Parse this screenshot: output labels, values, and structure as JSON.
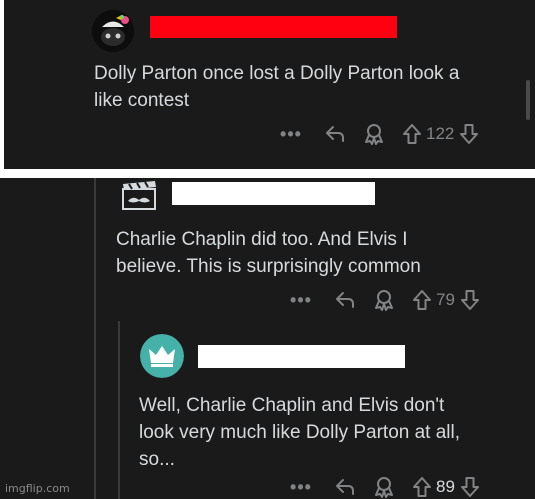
{
  "comments": [
    {
      "text_lines": [
        "Dolly Parton once lost a Dolly Parton look a",
        "like contest"
      ],
      "username_redaction_color": "#ff0011",
      "score": "122"
    },
    {
      "text_lines": [
        "Charlie Chaplin did too. And Elvis I",
        "believe. This is surprisingly common"
      ],
      "username_redaction_color": "#ffffff",
      "score": "79"
    },
    {
      "text_lines": [
        "Well, Charlie Chaplin and Elvis don't",
        "look very much like Dolly Parton at all,",
        "so..."
      ],
      "username_redaction_color": "#ffffff",
      "score": "89"
    }
  ],
  "icons": {
    "more": "more-dots-icon",
    "reply": "reply-arrow-icon",
    "award": "award-icon",
    "upvote": "upvote-arrow-icon",
    "downvote": "downvote-arrow-icon"
  },
  "colors": {
    "background": "#1a1a1b",
    "text": "#d7dadc",
    "muted": "#818384",
    "crown_avatar": "#46b1a8"
  },
  "watermark": "imgflip.com"
}
